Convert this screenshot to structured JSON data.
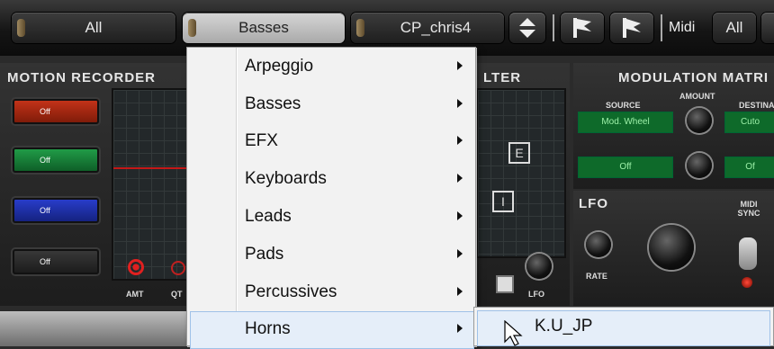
{
  "toolbar": {
    "selector_all": "All",
    "selector_category": "Basses",
    "preset_name": "CP_chris4",
    "midi_label": "Midi",
    "midi_value": "All"
  },
  "panels": {
    "motion_recorder": {
      "title": "MOTION RECORDER",
      "buttons": [
        "Off",
        "Off",
        "Off",
        "Off"
      ],
      "amt_label": "AMT",
      "qt_label": "QT"
    },
    "filter": {
      "title": "LTER",
      "mode_e": "E",
      "mode_i": "I",
      "lfo_label": "LFO"
    },
    "modulation_matrix": {
      "title": "MODULATION MATRI",
      "source_label": "SOURCE",
      "amount_label": "AMOUNT",
      "destination_label": "DESTINA",
      "row1_source": "Mod. Wheel",
      "row1_dest": "Cuto",
      "row2_source": "Off",
      "row2_dest": "Of"
    },
    "lfo": {
      "title": "LFO",
      "rate_label": "RATE",
      "midi_sync_label": "MIDI SYNC"
    }
  },
  "menu": {
    "items": [
      {
        "label": "Arpeggio"
      },
      {
        "label": "Basses"
      },
      {
        "label": "EFX"
      },
      {
        "label": "Keyboards"
      },
      {
        "label": "Leads"
      },
      {
        "label": "Pads"
      },
      {
        "label": "Percussives"
      },
      {
        "label": "Horns"
      }
    ],
    "highlighted": "Horns"
  },
  "submenu": {
    "items": [
      {
        "label": "K.U_JP"
      }
    ]
  },
  "colors": {
    "menu_bg": "#f2f2f2",
    "highlight": "#e5eef9",
    "highlight_border": "#9fc1e8"
  }
}
